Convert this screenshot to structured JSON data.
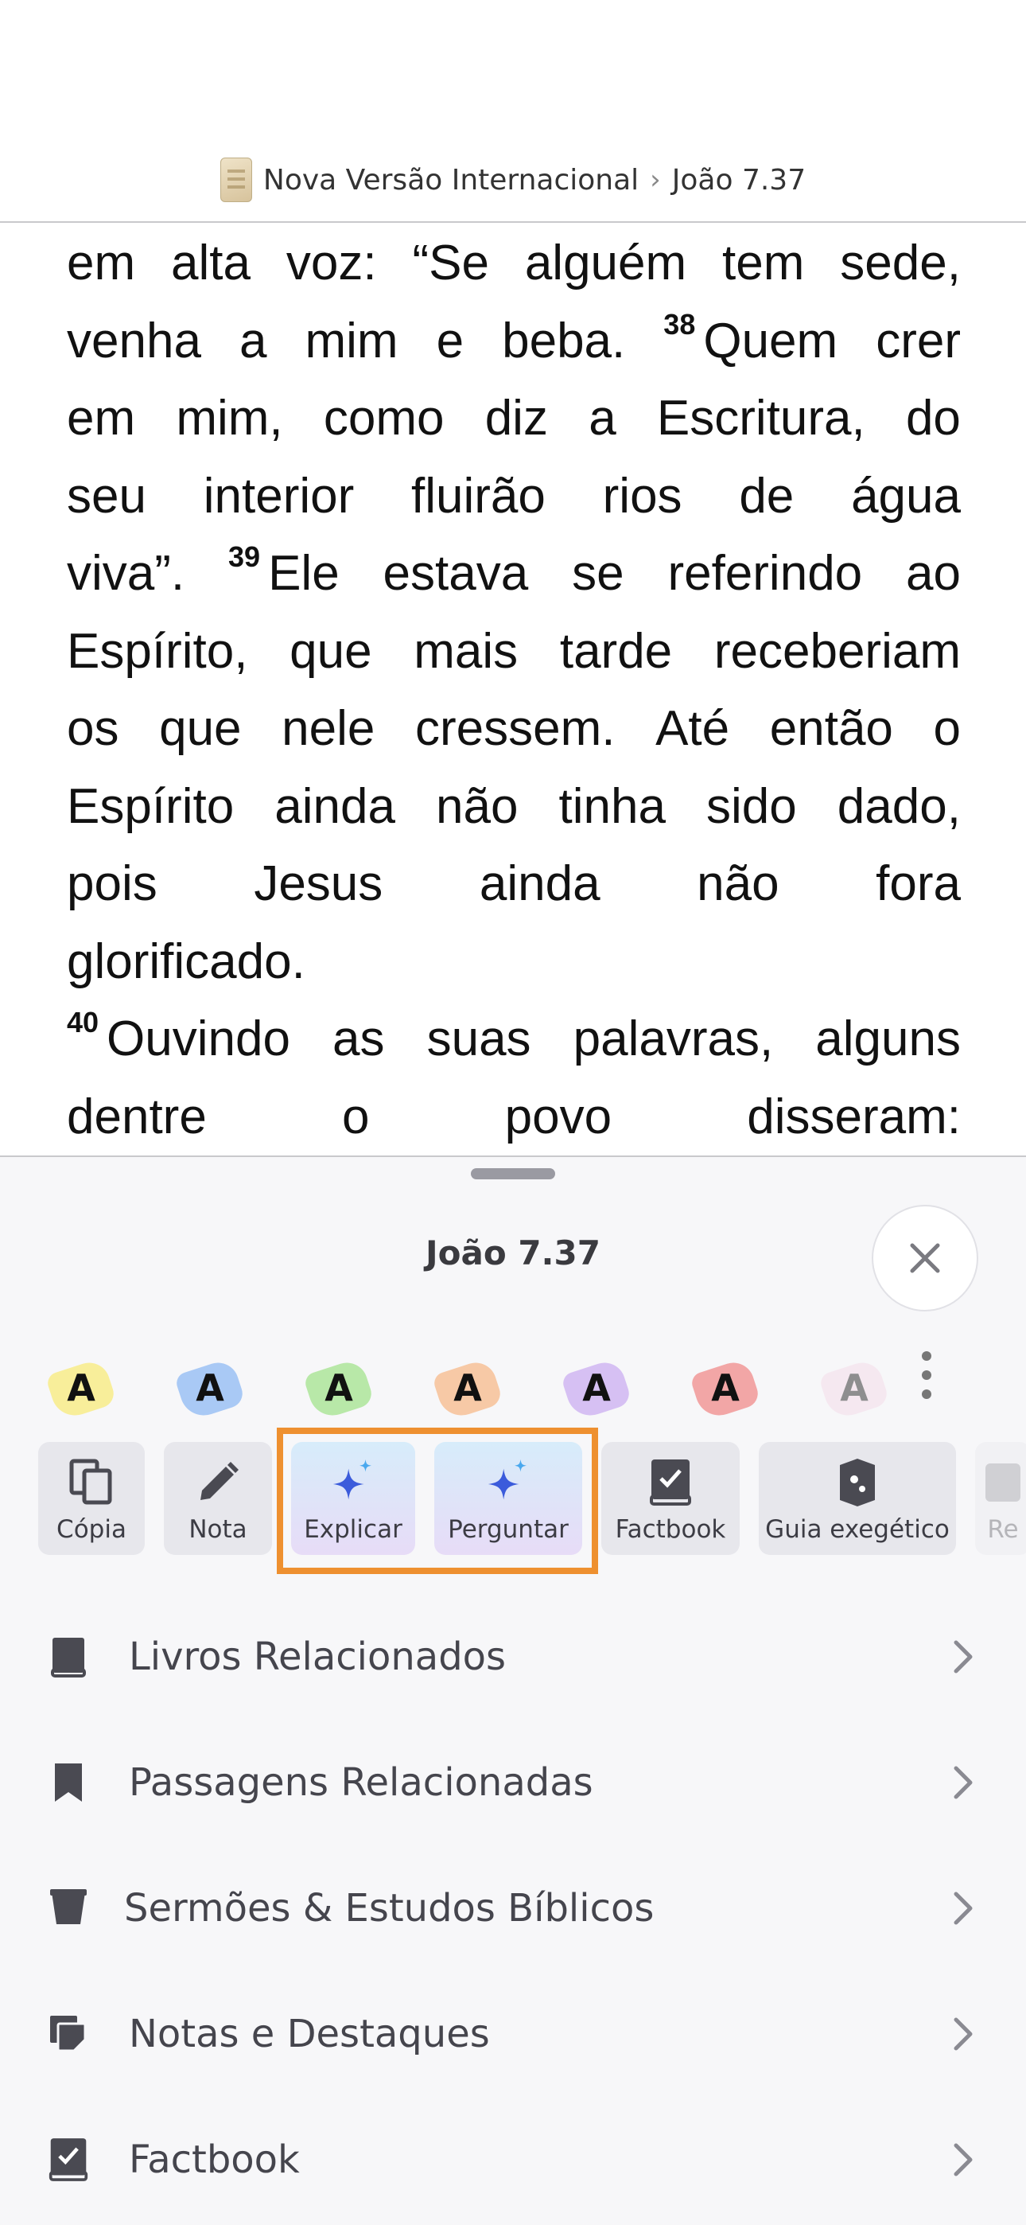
{
  "header": {
    "translation": "Nova Versão Internacional",
    "separator": "›",
    "reference": "João 7.37"
  },
  "scripture": {
    "lines": [
      [
        "em",
        "alta",
        "voz:",
        "“Se",
        "alguém",
        "tem",
        "sede,"
      ],
      [
        "venha",
        "a",
        "mim",
        "e",
        "beba.",
        "|38|Quem",
        "crer"
      ],
      [
        "em",
        "mim,",
        "como",
        "diz",
        "a",
        "Escritura,",
        "do"
      ],
      [
        "seu",
        "interior",
        "fluirão",
        "rios",
        "de",
        "água"
      ],
      [
        "viva”.",
        "|39|Ele",
        "estava",
        "se",
        "referindo",
        "ao"
      ],
      [
        "Espírito,",
        "que",
        "mais",
        "tarde",
        "receberiam"
      ],
      [
        "os",
        "que",
        "nele",
        "cressem.",
        "Até",
        "então",
        "o"
      ],
      [
        "Espírito",
        "ainda",
        "não",
        "tinha",
        "sido",
        "dado,"
      ],
      [
        "pois",
        "Jesus",
        "ainda",
        "não",
        "fora"
      ],
      [
        "glorificado."
      ],
      [
        "|40|Ouvindo",
        "as",
        "suas",
        "palavras,",
        "alguns"
      ],
      [
        "dentre",
        "o",
        "povo",
        "disseram:"
      ]
    ]
  },
  "sheet": {
    "title": "João 7.37",
    "highlight_letter": "A",
    "highlight_colors": [
      "#f8ee9a",
      "#a9c9f5",
      "#b8e8a8",
      "#f7c9a6",
      "#d6c0f3",
      "#f2a6a6",
      "#f4d6e6"
    ],
    "actions": [
      {
        "label": "Cópia",
        "icon": "copy-icon"
      },
      {
        "label": "Nota",
        "icon": "pencil-icon"
      },
      {
        "label": "Explicar",
        "icon": "sparkle-icon"
      },
      {
        "label": "Perguntar",
        "icon": "sparkle-icon"
      },
      {
        "label": "Factbook",
        "icon": "factbook-icon"
      },
      {
        "label": "Guia exegético",
        "icon": "guide-icon"
      },
      {
        "label": "Re",
        "icon": "partial-icon"
      }
    ],
    "list": [
      {
        "label": "Livros Relacionados",
        "icon": "book-icon"
      },
      {
        "label": "Passagens Relacionadas",
        "icon": "bookmark-icon"
      },
      {
        "label": "Sermões & Estudos Bíblicos",
        "icon": "lectern-icon"
      },
      {
        "label": "Notas e Destaques",
        "icon": "notes-icon"
      },
      {
        "label": "Factbook",
        "icon": "factbook-icon"
      }
    ]
  },
  "colors": {
    "focus_outline": "#ee9030",
    "sparkle_blue": "#3b5bdb",
    "sparkle_light": "#4aa8ee"
  }
}
